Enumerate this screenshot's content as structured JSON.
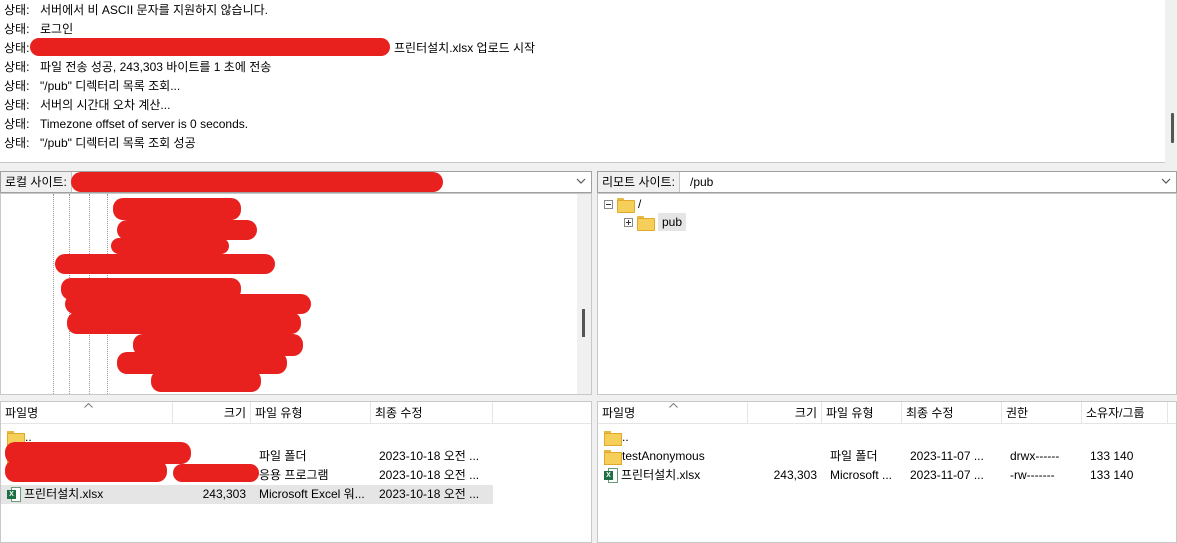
{
  "log": {
    "lines": [
      {
        "label": "상태:",
        "text": "서버에서 비 ASCII 문자를 지원하지 않습니다."
      },
      {
        "label": "상태:",
        "text": "로그인"
      },
      {
        "label": "상태:",
        "text": "프린터설치.xlsx 업로드 시작"
      },
      {
        "label": "상태:",
        "text": "파일 전송 성공, 243,303 바이트를 1 초에 전송"
      },
      {
        "label": "상태:",
        "text": "\"/pub\" 디렉터리 목록 조회..."
      },
      {
        "label": "상태:",
        "text": "서버의 시간대 오차 계산..."
      },
      {
        "label": "상태:",
        "text": "Timezone offset of server is 0 seconds."
      },
      {
        "label": "상태:",
        "text": "\"/pub\" 디렉터리 목록 조회 성공"
      }
    ]
  },
  "local": {
    "site_label": "로컬 사이트:",
    "site_value": "",
    "columns": [
      "파일명",
      "크기",
      "파일 유형",
      "최종 수정"
    ],
    "rows": [
      {
        "name": "..",
        "size": "",
        "type": "",
        "modified": "",
        "icon": "folder-icon"
      },
      {
        "name": "",
        "size": "",
        "type": "파일 폴더",
        "modified": "2023-10-18 오전 ...",
        "icon": "folder-icon"
      },
      {
        "name": "",
        "size": "",
        "type": "응용 프로그램",
        "modified": "2023-10-18 오전 ...",
        "icon": "app-icon"
      },
      {
        "name": "프린터설치.xlsx",
        "size": "243,303",
        "type": "Microsoft Excel 워...",
        "modified": "2023-10-18 오전 ...",
        "icon": "excel-icon"
      }
    ]
  },
  "remote": {
    "site_label": "리모트 사이트:",
    "site_value": "/pub",
    "tree": [
      {
        "label": "/"
      },
      {
        "label": "pub"
      }
    ],
    "columns": [
      "파일명",
      "크기",
      "파일 유형",
      "최종 수정",
      "권한",
      "소유자/그룹"
    ],
    "rows": [
      {
        "name": "..",
        "size": "",
        "type": "",
        "modified": "",
        "perm": "",
        "owner": "",
        "icon": "folder-icon"
      },
      {
        "name": "testAnonymous",
        "size": "",
        "type": "파일 폴더",
        "modified": "2023-11-07 ...",
        "perm": "drwx------",
        "owner": "133 140",
        "icon": "folder-icon"
      },
      {
        "name": "프린터설치.xlsx",
        "size": "243,303",
        "type": "Microsoft ...",
        "modified": "2023-11-07 ...",
        "perm": "-rw-------",
        "owner": "133 140",
        "icon": "excel-icon"
      }
    ]
  },
  "colors": {
    "redaction": "#e8201e",
    "selection": "#e5e5e5",
    "excel": "#1d7044",
    "folder": "#f6cf5b"
  }
}
